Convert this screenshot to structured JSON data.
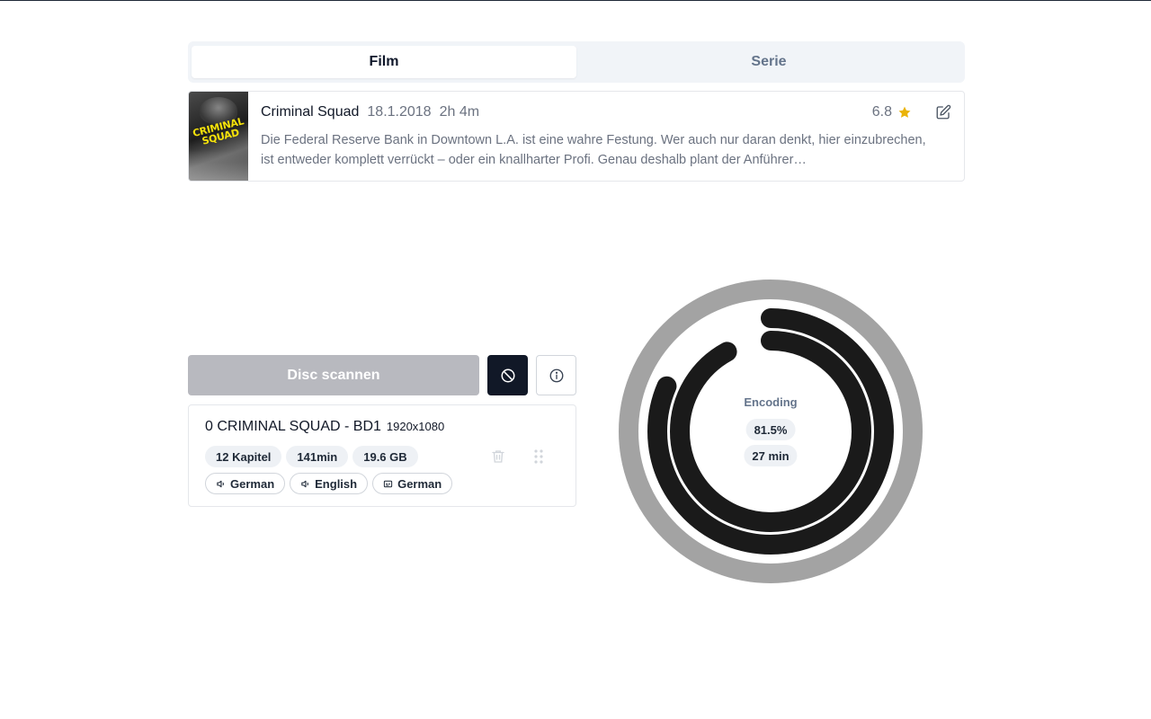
{
  "tabs": [
    {
      "label": "Film",
      "active": true
    },
    {
      "label": "Serie",
      "active": false
    }
  ],
  "movie": {
    "poster_text": "CRIMINAL SQUAD",
    "title": "Criminal Squad",
    "release_date": "18.1.2018",
    "runtime": "2h 4m",
    "rating": "6.8",
    "description": "Die Federal Reserve Bank in Downtown L.A. ist eine wahre Festung. Wer auch nur daran denkt, hier einzubrechen, ist entweder komplett verrückt – oder ein knallharter Profi. Genau deshalb plant der Anführer…",
    "icons": {
      "rating": "star-icon",
      "edit": "pencil-square-icon"
    }
  },
  "actions": {
    "scan_label": "Disc scannen",
    "cancel_icon": "ban-icon",
    "info_icon": "info-icon"
  },
  "disc_title": {
    "name": "0 CRIMINAL SQUAD - BD1",
    "resolution": "1920x1080",
    "stats": [
      "12 Kapitel",
      "141min",
      "19.6 GB"
    ],
    "audio_tracks": [
      "German",
      "English"
    ],
    "subtitle_tracks": [
      "German"
    ]
  },
  "progress": {
    "label": "Encoding",
    "percent": "81.5%",
    "remaining": "27 min",
    "outer_fraction": 0.815,
    "inner_fraction": 0.92
  },
  "colors": {
    "accent": "#111827",
    "track": "#a3a3a3",
    "progress": "#1a1a1a",
    "star": "#eab308",
    "muted": "#6b7280"
  }
}
